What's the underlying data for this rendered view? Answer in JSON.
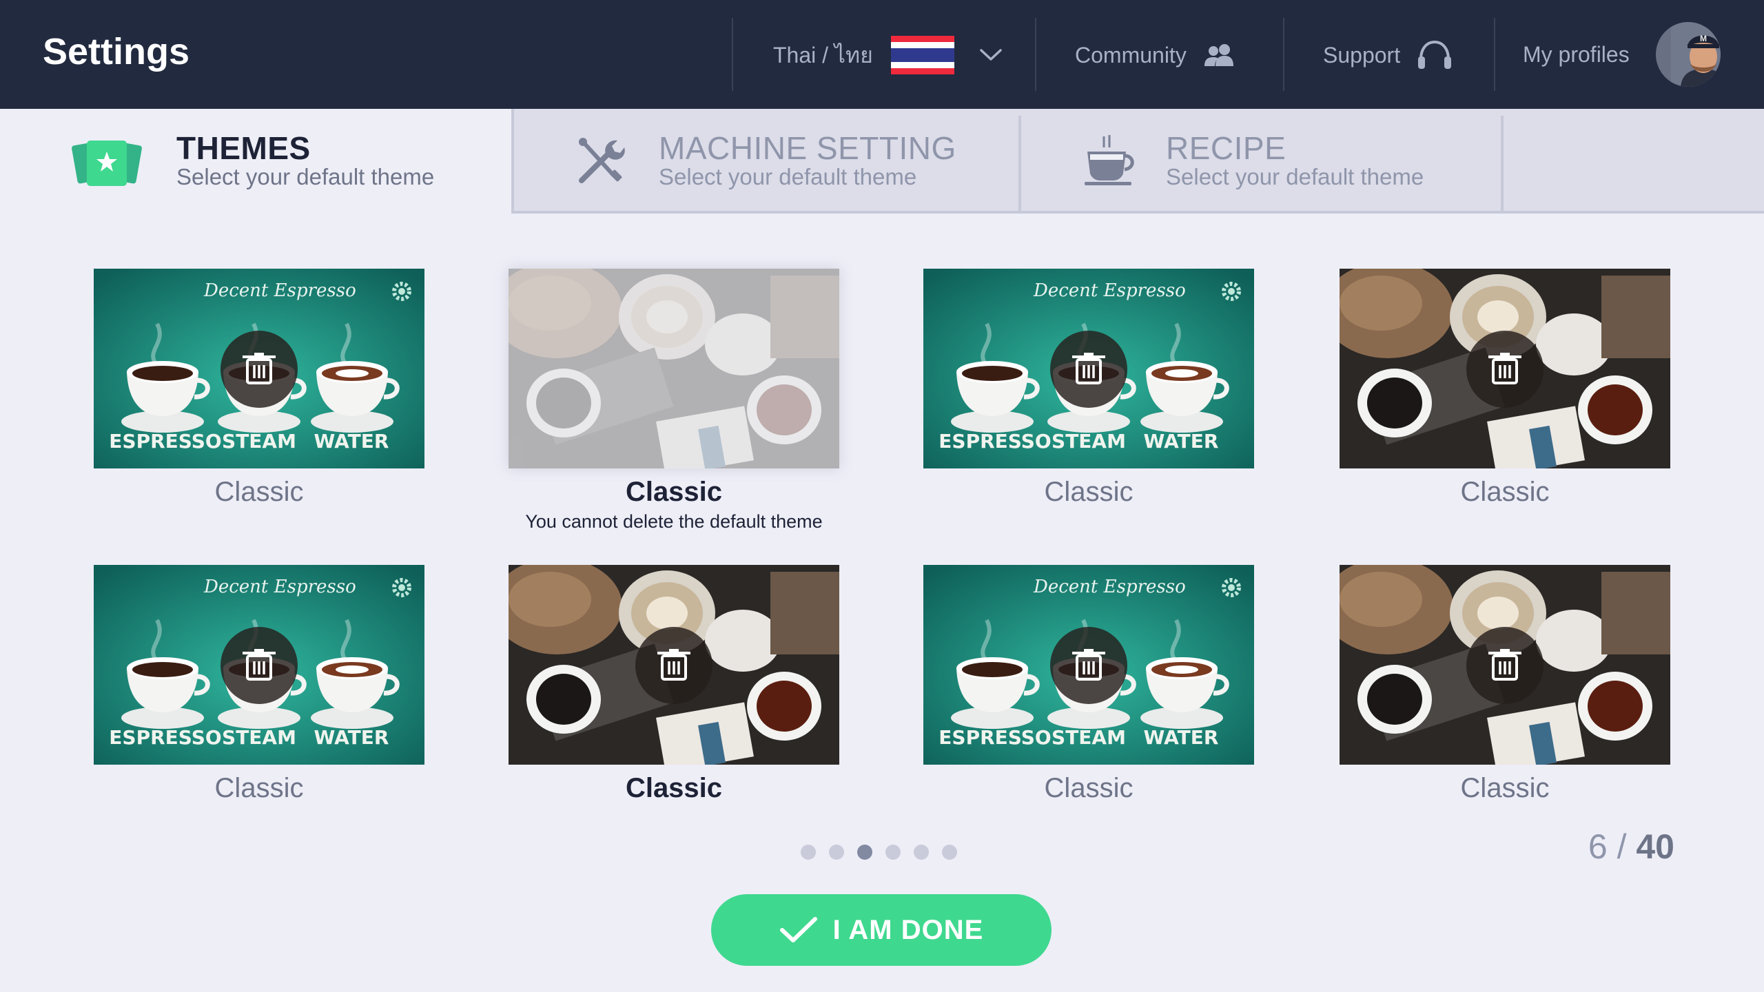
{
  "header": {
    "title": "Settings",
    "language": "Thai / ไทย",
    "community": "Community",
    "support": "Support",
    "profiles": "My profiles"
  },
  "tabs": [
    {
      "title": "THEMES",
      "subtitle": "Select your default theme",
      "active": true,
      "icon": "themes-cards-icon"
    },
    {
      "title": "MACHINE SETTING",
      "subtitle": "Select your default theme",
      "active": false,
      "icon": "wrench-screwdriver-icon"
    },
    {
      "title": "RECIPE",
      "subtitle": "Select your default theme",
      "active": false,
      "icon": "coffee-cup-icon"
    }
  ],
  "themes": [
    {
      "name": "Classic",
      "style": "green",
      "selected": false
    },
    {
      "name": "Classic",
      "style": "photo-faded",
      "selected": true,
      "note": "You cannot delete the default theme"
    },
    {
      "name": "Classic",
      "style": "green",
      "selected": false
    },
    {
      "name": "Classic",
      "style": "photo",
      "selected": false
    },
    {
      "name": "Classic",
      "style": "green",
      "selected": false
    },
    {
      "name": "Classic",
      "style": "photo",
      "selected": true
    },
    {
      "name": "Classic",
      "style": "green",
      "selected": false
    },
    {
      "name": "Classic",
      "style": "photo",
      "selected": false
    }
  ],
  "green_theme_text": {
    "brand": "Decent Espresso",
    "espresso": "ESPRESSO",
    "steam": "STEAM",
    "water": "WATER"
  },
  "pagination": {
    "pages": 6,
    "active_page": 3,
    "current": "6",
    "separator": "/",
    "total": "40"
  },
  "done_button": "I AM DONE",
  "colors": {
    "header_bg": "#222a3f",
    "accent": "#3fd88f",
    "page_bg": "#eeeef7",
    "tab_bg": "#dcdde9"
  }
}
